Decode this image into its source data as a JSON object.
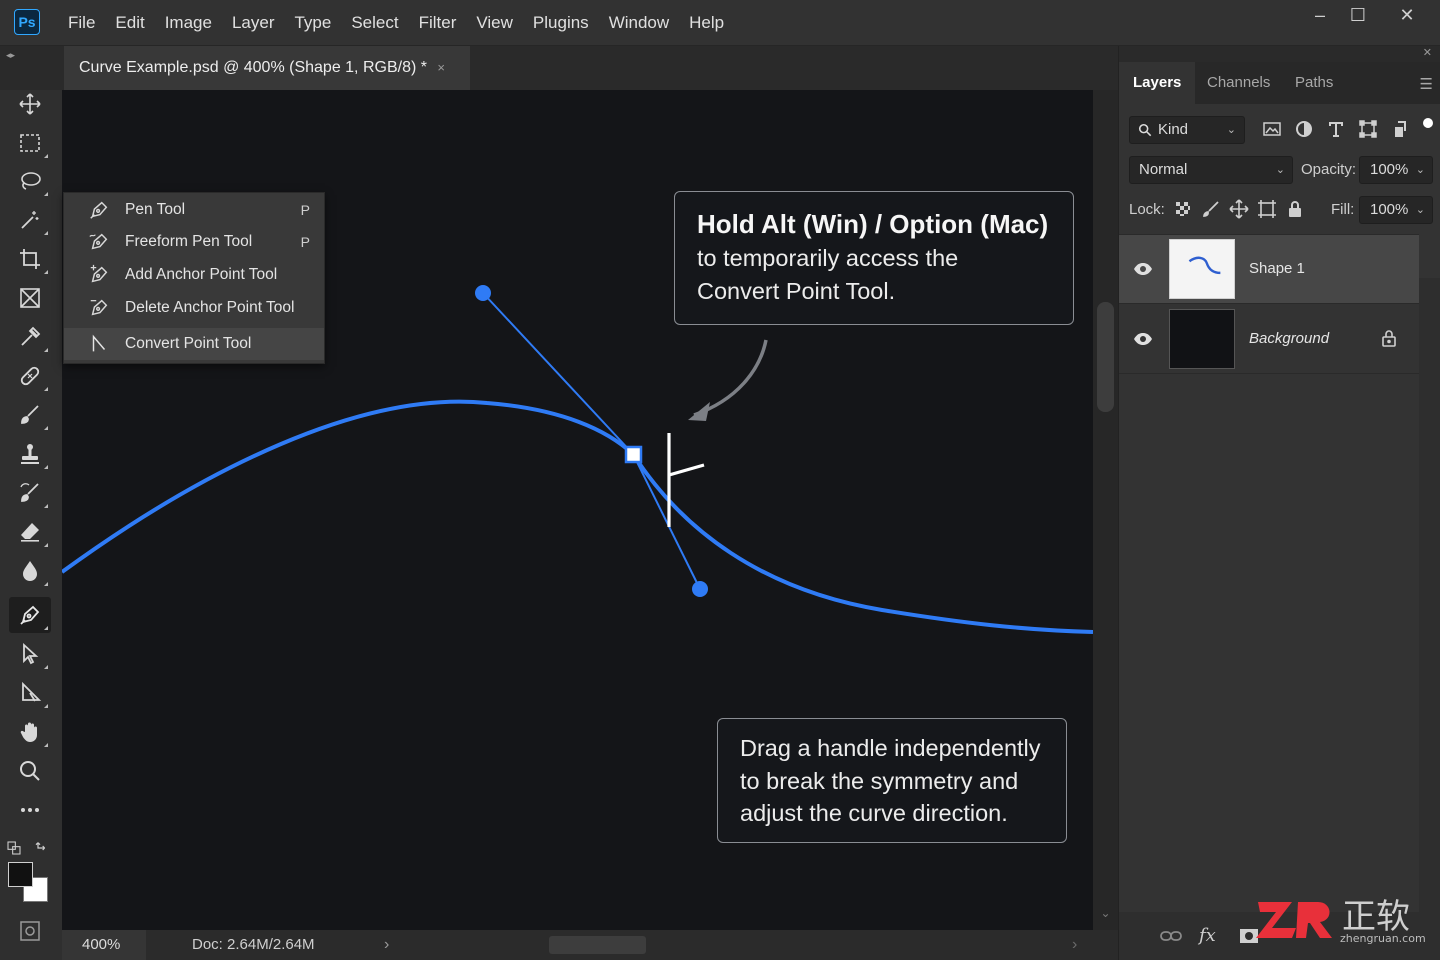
{
  "app": {
    "logo_text": "Ps"
  },
  "menu": [
    "File",
    "Edit",
    "Image",
    "Layer",
    "Type",
    "Select",
    "Filter",
    "View",
    "Plugins",
    "Window",
    "Help"
  ],
  "window_controls": {
    "minimize": "–",
    "maximize": "☐",
    "close": "✕"
  },
  "document_tab": {
    "title": "Curve Example.psd @ 400% (Shape 1, RGB/8) *",
    "close": "×"
  },
  "toolbar": {
    "tools": [
      {
        "name": "move-tool-icon"
      },
      {
        "name": "marquee-tool-icon"
      },
      {
        "name": "lasso-tool-icon"
      },
      {
        "name": "magic-wand-tool-icon"
      },
      {
        "name": "crop-tool-icon"
      },
      {
        "name": "frame-tool-icon"
      },
      {
        "name": "eyedropper-tool-icon"
      },
      {
        "name": "healing-brush-tool-icon"
      },
      {
        "name": "brush-tool-icon"
      },
      {
        "name": "clone-stamp-tool-icon"
      },
      {
        "name": "history-brush-tool-icon"
      },
      {
        "name": "eraser-tool-icon"
      },
      {
        "name": "blur-tool-icon"
      },
      {
        "name": "pen-tool-icon",
        "active": true
      },
      {
        "name": "path-selection-tool-icon"
      },
      {
        "name": "direct-selection-tool-icon"
      },
      {
        "name": "hand-tool-icon"
      },
      {
        "name": "zoom-tool-icon"
      },
      {
        "name": "more-tools-icon"
      }
    ],
    "foreground_color": "#111111",
    "background_color": "#ffffff"
  },
  "pen_flyout": {
    "items": [
      {
        "label": "Pen Tool",
        "shortcut": "P",
        "icon": "pen-icon"
      },
      {
        "label": "Freeform Pen Tool",
        "shortcut": "P",
        "icon": "freeform-pen-icon"
      },
      {
        "label": "Add Anchor Point Tool",
        "shortcut": "",
        "icon": "add-anchor-icon"
      },
      {
        "label": "Delete Anchor Point Tool",
        "shortcut": "",
        "icon": "delete-anchor-icon"
      },
      {
        "label": "Convert Point Tool",
        "shortcut": "",
        "icon": "convert-point-icon",
        "selected": true
      }
    ]
  },
  "callouts": {
    "alt_hint": {
      "line1": "Hold Alt (Win) / Option (Mac)",
      "line2": "to temporarily access the",
      "line3": "Convert Point Tool."
    },
    "drag_hint": {
      "line1": "Drag a handle independently",
      "line2": "to break the symmetry and",
      "line3": "adjust the curve direction."
    }
  },
  "canvas": {
    "path_color": "#2f7bf5",
    "background": "#141518"
  },
  "status": {
    "zoom": "400%",
    "doc": "Doc: 2.64M/2.64M",
    "arrow": "›"
  },
  "layers_panel": {
    "tabs": [
      {
        "label": "Layers",
        "active": true
      },
      {
        "label": "Channels"
      },
      {
        "label": "Paths"
      }
    ],
    "filter_kind": "Kind",
    "blend_mode": "Normal",
    "opacity_label": "Opacity:",
    "opacity": "100%",
    "lock_label": "Lock:",
    "fill_label": "Fill:",
    "fill": "100%",
    "layers": [
      {
        "name": "Shape 1",
        "selected": true,
        "visible": true
      },
      {
        "name": "Background",
        "selected": false,
        "visible": true,
        "locked": true
      }
    ]
  },
  "watermark": {
    "text": "ZR 正软",
    "sub": "zhengruan.com"
  }
}
